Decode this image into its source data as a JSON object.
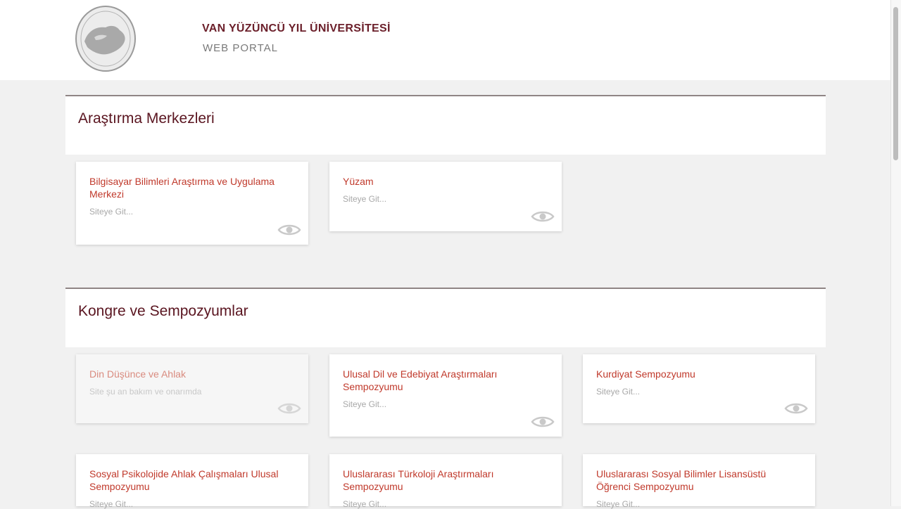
{
  "header": {
    "title": "VAN YÜZÜNCÜ YIL ÜNİVERSİTESİ",
    "subtitle": "WEB PORTAL",
    "logo_icon": "university-seal"
  },
  "sections": [
    {
      "title": "Araştırma Merkezleri",
      "cards": [
        {
          "title": "Bilgisayar Bilimleri Araştırma ve Uygulama Merkezi",
          "link": "Siteye Git..."
        },
        {
          "title": "Yüzam",
          "link": "Siteye Git..."
        }
      ]
    },
    {
      "title": "Kongre ve Sempozyumlar",
      "cards": [
        {
          "title": "Din Düşünce ve Ahlak",
          "link": "Site şu an bakım ve onarımda",
          "disabled": true
        },
        {
          "title": "Ulusal Dil ve Edebiyat Araştırmaları Sempozyumu",
          "link": "Siteye Git..."
        },
        {
          "title": "Kurdiyat Sempozyumu",
          "link": "Siteye Git..."
        },
        {
          "title": "Sosyal Psikolojide Ahlak Çalışmaları Ulusal Sempozyumu",
          "link": "Siteye Git..."
        },
        {
          "title": "Uluslararası Türkoloji Araştırmaları Sempozyumu",
          "link": "Siteye Git..."
        },
        {
          "title": "Uluslararası Sosyal Bilimler Lisansüstü Öğrenci Sempozyumu",
          "link": "Siteye Git..."
        }
      ]
    }
  ],
  "colors": {
    "accent": "#c0392b",
    "brand": "#6b1f2a",
    "background": "#f1f1f1"
  },
  "card_icon": "eye-icon"
}
